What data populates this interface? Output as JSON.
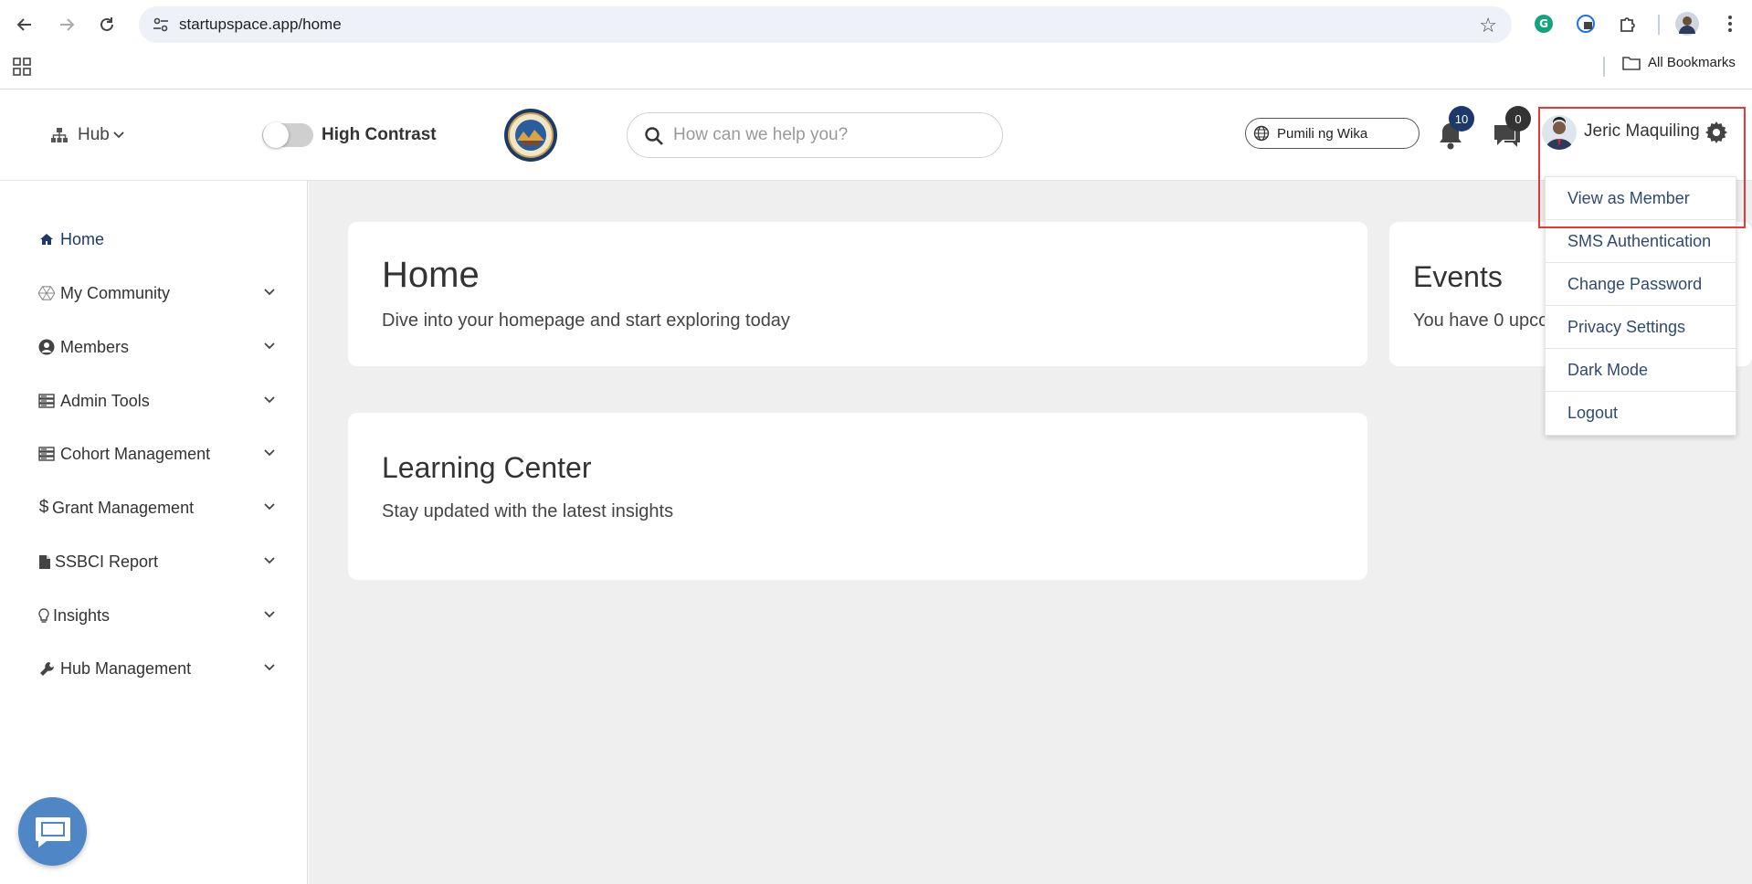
{
  "browser": {
    "url": "startupspace.app/home",
    "bookmarks_label": "All Bookmarks"
  },
  "header": {
    "hub_label": "Hub",
    "high_contrast_label": "High Contrast",
    "search_placeholder": "How can we help you?",
    "language_label": "Pumili ng Wika",
    "notification_count": "10",
    "message_count": "0",
    "user_name": "Jeric Maquiling"
  },
  "user_menu": {
    "items": [
      "View as Member",
      "SMS Authentication",
      "Change Password",
      "Privacy Settings",
      "Dark Mode",
      "Logout"
    ]
  },
  "sidebar": {
    "items": [
      {
        "label": "Home",
        "icon": "home-icon"
      },
      {
        "label": "My Community",
        "icon": "community-icon"
      },
      {
        "label": "Members",
        "icon": "user-circle-icon"
      },
      {
        "label": "Admin Tools",
        "icon": "server-icon"
      },
      {
        "label": "Cohort Management",
        "icon": "server-icon"
      },
      {
        "label": "Grant Management",
        "icon": "dollar-icon"
      },
      {
        "label": "SSBCI Report",
        "icon": "file-icon"
      },
      {
        "label": "Insights",
        "icon": "lightbulb-icon"
      },
      {
        "label": "Hub Management",
        "icon": "wrench-icon"
      }
    ]
  },
  "main": {
    "home_card": {
      "title": "Home",
      "subtitle": "Dive into your homepage and start exploring today"
    },
    "events_card": {
      "title": "Events",
      "subtitle": "You have 0 upco"
    },
    "learning_card": {
      "title": "Learning Center",
      "subtitle": "Stay updated with the latest insights"
    }
  },
  "colors": {
    "brand_navy": "#1b3a6b",
    "menu_link": "#2f4a72",
    "highlight_red": "#e53935",
    "chat_widget": "#4f86c6",
    "page_bg": "#efefef"
  }
}
